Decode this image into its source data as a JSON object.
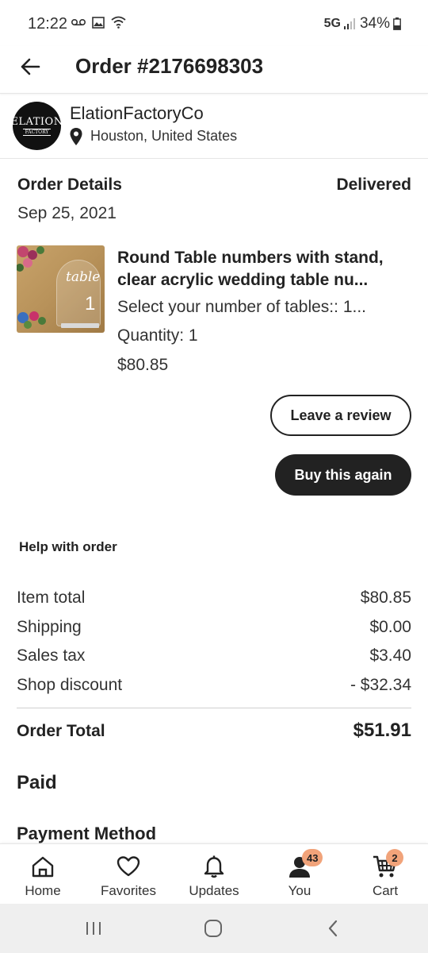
{
  "status_bar": {
    "time": "12:22",
    "network": "5G",
    "battery": "34%"
  },
  "header": {
    "title": "Order #2176698303"
  },
  "shop": {
    "name": "ElationFactoryCo",
    "location": "Houston, United States",
    "logo_text_main": "ELATION",
    "logo_text_sub": "FACTORY"
  },
  "order": {
    "details_label": "Order Details",
    "status": "Delivered",
    "date": "Sep 25, 2021"
  },
  "product": {
    "title_line1": "Round Table numbers with stand,",
    "title_line2": "clear acrylic wedding table nu...",
    "variation": "Select your number of tables:: 1...",
    "quantity": "Quantity: 1",
    "price": "$80.85",
    "image_text_word": "table",
    "image_text_number": "1"
  },
  "actions": {
    "review_label": "Leave a review",
    "buy_again_label": "Buy this again",
    "help_label": "Help with order"
  },
  "summary": {
    "rows": [
      {
        "label": "Item total",
        "value": "$80.85"
      },
      {
        "label": "Shipping",
        "value": "$0.00"
      },
      {
        "label": "Sales tax",
        "value": "$3.40"
      },
      {
        "label": "Shop discount",
        "value": "- $32.34"
      }
    ],
    "total_label": "Order Total",
    "total_value": "$51.91",
    "paid_label": "Paid",
    "payment_method_label": "Payment Method"
  },
  "bottom_nav": {
    "items": [
      {
        "label": "Home",
        "icon": "home-icon"
      },
      {
        "label": "Favorites",
        "icon": "heart-icon"
      },
      {
        "label": "Updates",
        "icon": "bell-icon"
      },
      {
        "label": "You",
        "icon": "person-icon",
        "badge": "43"
      },
      {
        "label": "Cart",
        "icon": "cart-icon",
        "badge": "2"
      }
    ]
  },
  "colors": {
    "primary_dark": "#222222",
    "badge": "#f1a37a",
    "divider": "#e6e6e6"
  }
}
